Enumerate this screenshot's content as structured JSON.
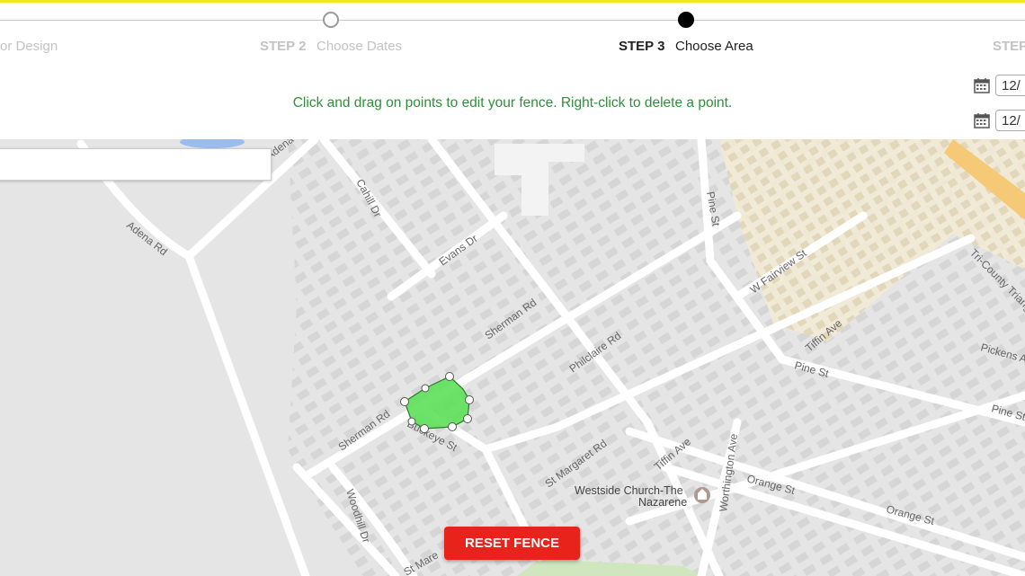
{
  "steps": {
    "step1_label": "or Design",
    "step2_num": "STEP 2",
    "step2_label": "Choose Dates",
    "step3_num": "STEP 3",
    "step3_label": "Choose Area",
    "step4_num": "STEP"
  },
  "instructions": "Click and drag on points to edit your fence. Right-click to delete a point.",
  "dates": {
    "start_value": "12/",
    "end_value": "12/"
  },
  "map": {
    "labels": {
      "adena_rd_top": "Adena Rd",
      "adena_rd_left": "Adena Rd",
      "cahill_dr": "Cahill Dr",
      "evans_dr": "Evans Dr",
      "pine_st_vertical": "Pine St",
      "w_fairview_st": "W Fairview St",
      "tri_county": "Tri-County Triang",
      "sherman_rd_mid": "Sherman Rd",
      "sherman_rd_low": "Sherman Rd",
      "philclaire_rd": "Philclaire Rd",
      "tiffin_ave_right": "Tiffin Ave",
      "pine_st_mid": "Pine St",
      "pine_st_right": "Pine St",
      "pickens": "Pickens A",
      "buckeye_st": "Buckeye St",
      "st_margaret_rd": "St Margaret Rd",
      "tiffin_ave_low": "Tiffin Ave",
      "worthington_ave": "Worthington Ave",
      "orange_st_1": "Orange St",
      "orange_st_2": "Orange St",
      "woodhill_dr": "Woodhill Dr",
      "st_mare": "St Mare",
      "church": "Westside Church-The",
      "church_2": "Nazarene"
    }
  },
  "reset_button": "RESET FENCE",
  "colors": {
    "accent_yellow": "#f5e61b",
    "fence_green": "#5ee05a",
    "reset_red": "#e8231b",
    "instruction_green": "#2f8f3a"
  }
}
